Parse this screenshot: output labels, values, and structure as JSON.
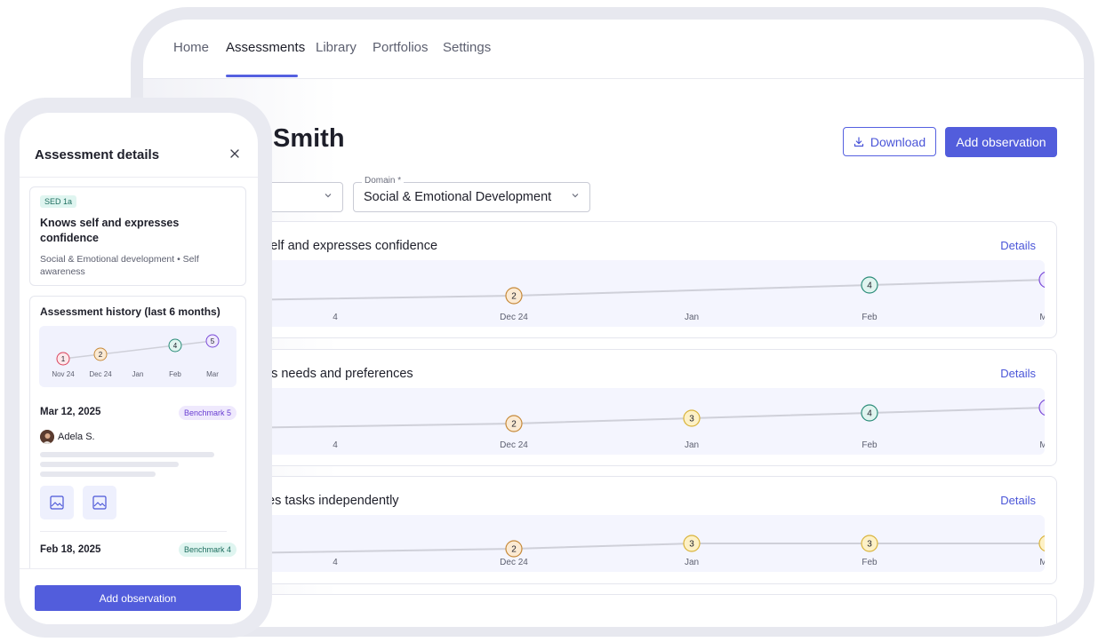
{
  "nav": {
    "items": [
      "Home",
      "Assessments",
      "Library",
      "Portfolios",
      "Settings"
    ],
    "active": "Assessments"
  },
  "student": {
    "name_visible": "Smith"
  },
  "actions": {
    "download_label": "Download",
    "add_observation_label": "Add observation"
  },
  "filters": {
    "domain_label": "Domain *",
    "domain_value": "Social & Emotional Development"
  },
  "colors": {
    "accent": "#525ddc",
    "level_1": "#d9435c",
    "level_2": "#c78a3a",
    "level_3": "#d9b33a",
    "level_4": "#2b8c79",
    "level_5": "#7a4bd8"
  },
  "cards": [
    {
      "title_visible": "self and expresses confidence",
      "details_label": "Details",
      "chart_data": {
        "type": "line",
        "categories": [
          "Nov 24",
          "Dec 24",
          "Jan",
          "Feb",
          "Mar"
        ],
        "tick_labels_visible": [
          "4",
          "Dec 24",
          "Jan",
          "Feb",
          "Mar"
        ],
        "values": [
          null,
          2,
          null,
          4,
          5
        ],
        "ylim": [
          0,
          6
        ]
      }
    },
    {
      "title_visible": "es needs and preferences",
      "details_label": "Details",
      "chart_data": {
        "type": "line",
        "categories": [
          "Nov 24",
          "Dec 24",
          "Jan",
          "Feb",
          "Mar"
        ],
        "tick_labels_visible": [
          "4",
          "Dec 24",
          "Jan",
          "Feb",
          "Mar"
        ],
        "values": [
          null,
          2,
          3,
          4,
          5
        ],
        "ylim": [
          0,
          6
        ]
      }
    },
    {
      "title_visible": "tes tasks independently",
      "details_label": "Details",
      "chart_data": {
        "type": "line",
        "categories": [
          "Nov 24",
          "Dec 24",
          "Jan",
          "Feb",
          "Mar"
        ],
        "tick_labels_visible": [
          "4",
          "Dec 24",
          "Jan",
          "Feb",
          "Mar"
        ],
        "values": [
          null,
          2,
          3,
          3,
          3
        ],
        "ylim": [
          0,
          6
        ]
      }
    }
  ],
  "phone": {
    "title": "Assessment details",
    "indicator": {
      "badge": "SED 1a",
      "title": "Knows self and expresses confidence",
      "subtitle": "Social & Emotional development • Self awareness"
    },
    "history": {
      "title": "Assessment history (last 6 months)",
      "chart_data": {
        "type": "line",
        "categories": [
          "Nov 24",
          "Dec 24",
          "Jan",
          "Feb",
          "Mar"
        ],
        "values": [
          1,
          2,
          null,
          4,
          5
        ],
        "ylim": [
          0,
          6
        ]
      }
    },
    "observations": [
      {
        "date": "Mar 12, 2025",
        "benchmark": "Benchmark 5",
        "author": "Adela S."
      },
      {
        "date": "Feb 18, 2025",
        "benchmark": "Benchmark 4"
      }
    ],
    "add_observation_label": "Add observation"
  }
}
